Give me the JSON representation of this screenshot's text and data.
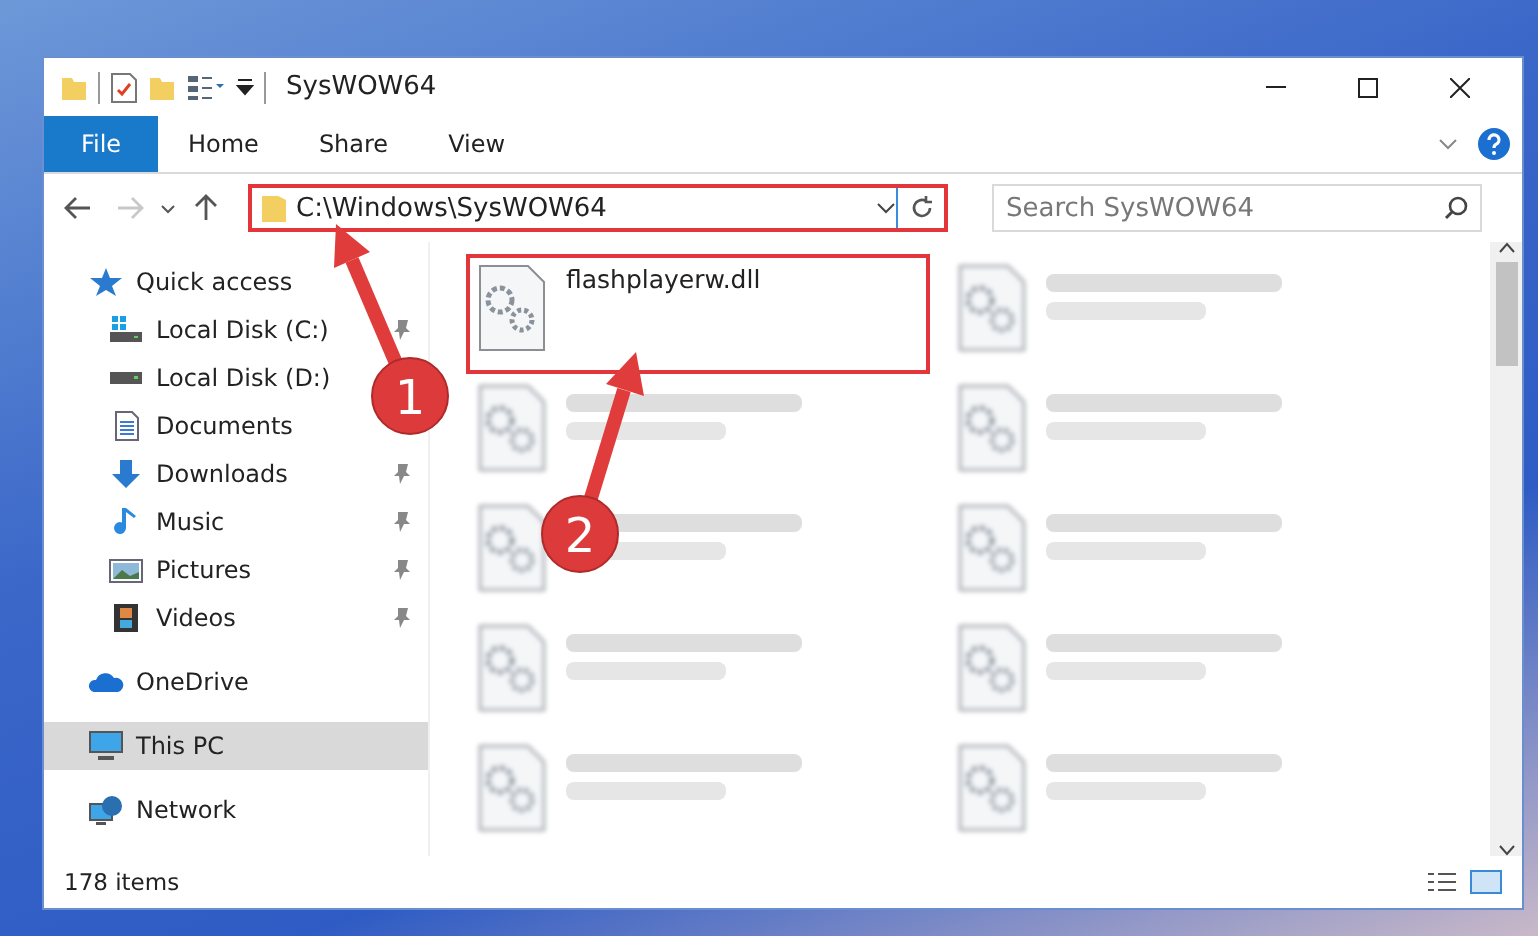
{
  "window": {
    "title": "SysWOW64"
  },
  "ribbon_tabs": [
    {
      "label": "File",
      "selected": true
    },
    {
      "label": "Home",
      "selected": false
    },
    {
      "label": "Share",
      "selected": false
    },
    {
      "label": "View",
      "selected": false
    }
  ],
  "navigation": {
    "forward_disabled": true,
    "address": {
      "value": "C:\\Windows\\SysWOW64",
      "highlighted": true
    },
    "search": {
      "placeholder": "Search SysWOW64"
    }
  },
  "sidebar": {
    "items": [
      {
        "label": "Quick access",
        "kind": "star",
        "selected": false,
        "pinned": false,
        "children": [
          {
            "label": "Local Disk (C:)",
            "kind": "system-drive",
            "selected": false,
            "pinned": true
          },
          {
            "label": "Local Disk (D:)",
            "kind": "drive",
            "selected": false,
            "pinned": false
          },
          {
            "label": "Documents",
            "kind": "documents",
            "selected": false,
            "pinned": false
          },
          {
            "label": "Downloads",
            "kind": "downloads",
            "selected": false,
            "pinned": true
          },
          {
            "label": "Music",
            "kind": "music",
            "selected": false,
            "pinned": true
          },
          {
            "label": "Pictures",
            "kind": "pictures",
            "selected": false,
            "pinned": true
          },
          {
            "label": "Videos",
            "kind": "videos",
            "selected": false,
            "pinned": true
          }
        ]
      },
      {
        "label": "OneDrive",
        "kind": "cloud",
        "selected": false,
        "pinned": false
      },
      {
        "label": "This PC",
        "kind": "computer",
        "selected": true,
        "pinned": false
      },
      {
        "label": "Network",
        "kind": "network",
        "selected": false,
        "pinned": false
      }
    ]
  },
  "files": [
    {
      "name": "flashplayerw.dll",
      "highlighted": true,
      "blurred": false
    },
    {
      "highlighted": false,
      "blurred": true
    },
    {
      "highlighted": false,
      "blurred": true
    },
    {
      "highlighted": false,
      "blurred": true
    },
    {
      "highlighted": false,
      "blurred": true
    },
    {
      "highlighted": false,
      "blurred": true
    },
    {
      "highlighted": false,
      "blurred": true
    },
    {
      "highlighted": false,
      "blurred": true
    },
    {
      "highlighted": false,
      "blurred": true
    },
    {
      "highlighted": false,
      "blurred": true
    }
  ],
  "status_bar": {
    "item_count": "178 items"
  },
  "annotations": [
    {
      "label": "1"
    },
    {
      "label": "2"
    }
  ]
}
